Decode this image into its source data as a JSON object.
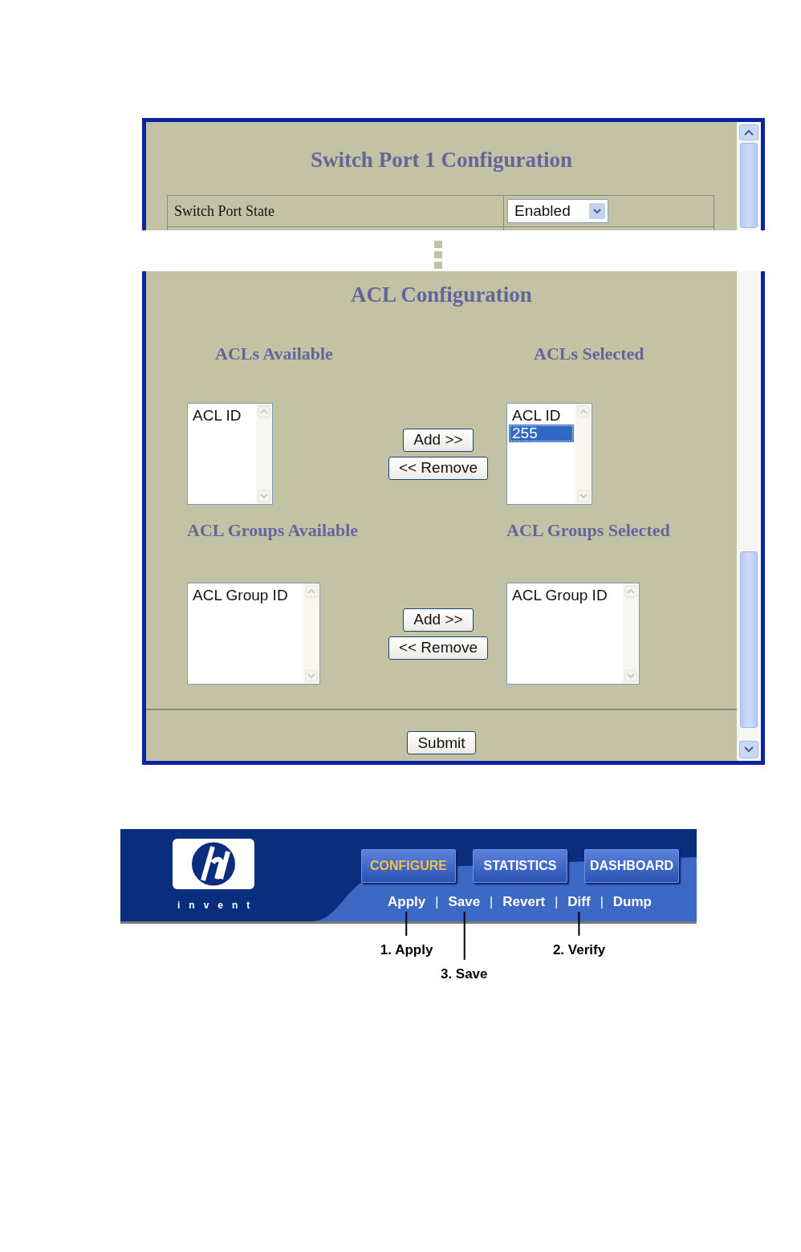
{
  "port_config": {
    "title": "Switch Port 1 Configuration",
    "rows": [
      {
        "label": "Switch Port State",
        "value": "Enabled"
      }
    ]
  },
  "acl_config": {
    "title": "ACL Configuration",
    "transfers": [
      {
        "available": {
          "title": "ACLs Available",
          "header": "ACL ID"
        },
        "selected": {
          "title": "ACLs Selected",
          "header": "ACL ID",
          "items": [
            {
              "text": "255",
              "selected": true
            }
          ]
        },
        "add_button": "Add >>",
        "remove_button": "<< Remove",
        "kind": "narrow"
      },
      {
        "available": {
          "title": "ACL Groups Available",
          "header": "ACL Group ID"
        },
        "selected": {
          "title": "ACL Groups Selected",
          "header": "ACL Group ID"
        },
        "add_button": "Add >>",
        "remove_button": "<< Remove",
        "kind": "wide"
      }
    ],
    "submit_button": "Submit"
  },
  "banner": {
    "tagline": "invent",
    "tabs": [
      {
        "label": "CONFIGURE",
        "selected": true
      },
      {
        "label": "STATISTICS",
        "selected": false
      },
      {
        "label": "DASHBOARD",
        "selected": false
      }
    ],
    "links": [
      {
        "label": "Apply",
        "separator": "|",
        "callout": {
          "text": "1. Apply",
          "kind": "near"
        }
      },
      {
        "label": "Save",
        "separator": "|",
        "callout": {
          "text": "3. Save",
          "kind": "far"
        }
      },
      {
        "label": "Revert",
        "separator": "|"
      },
      {
        "label": "Diff",
        "separator": "|",
        "callout": {
          "text": "2. Verify",
          "kind": "near"
        }
      },
      {
        "label": "Dump"
      }
    ]
  }
}
